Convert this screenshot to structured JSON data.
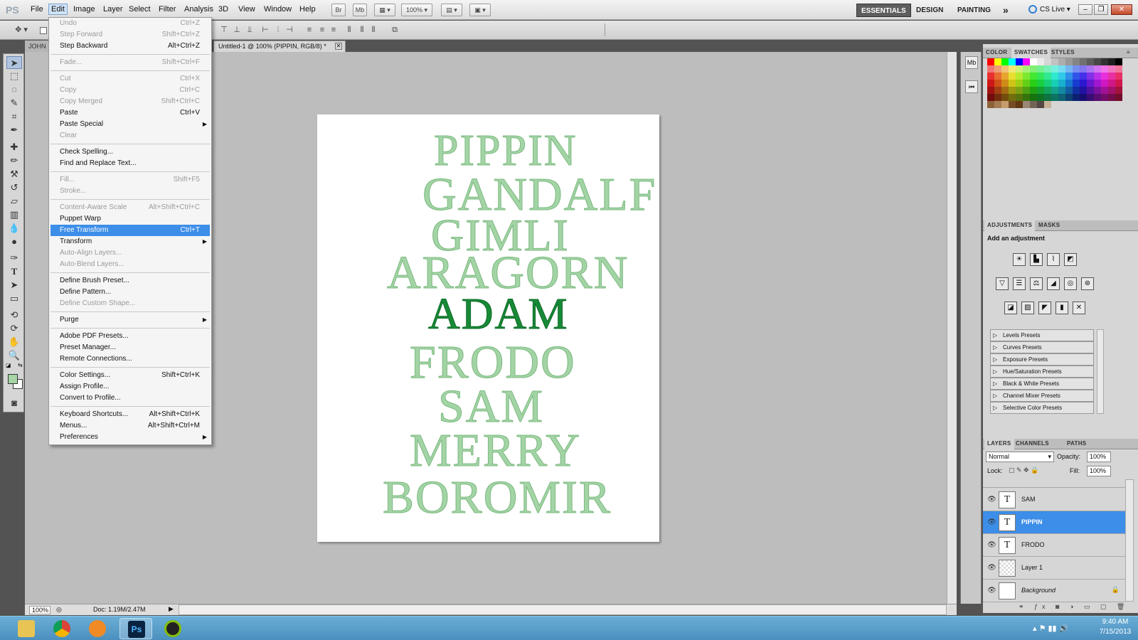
{
  "menubar": {
    "logo": "PS",
    "items": [
      "File",
      "Edit",
      "Image",
      "Layer",
      "Select",
      "Filter",
      "Analysis",
      "3D",
      "View",
      "Window",
      "Help"
    ],
    "zoom": "100%",
    "bridge": "Br",
    "minibridge": "Mb",
    "workspaces": [
      "ESSENTIALS",
      "DESIGN",
      "PAINTING"
    ],
    "more": "»",
    "cs_live": "CS Live"
  },
  "tabs": {
    "other": "JOHN",
    "active": "Untitled-1 @ 100% (PIPPIN, RGB/8) *"
  },
  "edit_menu": {
    "undo": "Undo",
    "undo_sc": "Ctrl+Z",
    "step_forward": "Step Forward",
    "step_forward_sc": "Shift+Ctrl+Z",
    "step_backward": "Step Backward",
    "step_backward_sc": "Alt+Ctrl+Z",
    "fade": "Fade...",
    "fade_sc": "Shift+Ctrl+F",
    "cut": "Cut",
    "cut_sc": "Ctrl+X",
    "copy": "Copy",
    "copy_sc": "Ctrl+C",
    "copy_merged": "Copy Merged",
    "copy_merged_sc": "Shift+Ctrl+C",
    "paste": "Paste",
    "paste_sc": "Ctrl+V",
    "paste_special": "Paste Special",
    "clear": "Clear",
    "check_spelling": "Check Spelling...",
    "find_replace": "Find and Replace Text...",
    "fill": "Fill...",
    "fill_sc": "Shift+F5",
    "stroke": "Stroke...",
    "content_aware": "Content-Aware Scale",
    "content_aware_sc": "Alt+Shift+Ctrl+C",
    "puppet_warp": "Puppet Warp",
    "free_transform": "Free Transform",
    "free_transform_sc": "Ctrl+T",
    "transform": "Transform",
    "auto_align": "Auto-Align Layers...",
    "auto_blend": "Auto-Blend Layers...",
    "define_brush": "Define Brush Preset...",
    "define_pattern": "Define Pattern...",
    "define_shape": "Define Custom Shape...",
    "purge": "Purge",
    "pdf_presets": "Adobe PDF Presets...",
    "preset_manager": "Preset Manager...",
    "remote": "Remote Connections...",
    "color_settings": "Color Settings...",
    "color_settings_sc": "Shift+Ctrl+K",
    "assign_profile": "Assign Profile...",
    "convert_profile": "Convert to Profile...",
    "keyboard": "Keyboard Shortcuts...",
    "keyboard_sc": "Alt+Shift+Ctrl+K",
    "menus": "Menus...",
    "menus_sc": "Alt+Shift+Ctrl+M",
    "preferences": "Preferences"
  },
  "canvas": {
    "names": [
      "PIPPIN",
      "GANDALF",
      "GIMLI",
      "ARAGORN",
      "ADAM",
      "FRODO",
      "SAM",
      "MERRY",
      "BOROMIR"
    ],
    "light_color": "#a3d4a5",
    "dark_color": "#178a36"
  },
  "status": {
    "zoom": "100%",
    "doc": "Doc: 1.19M/2.47M"
  },
  "panels": {
    "color_tabs": [
      "COLOR",
      "SWATCHES",
      "STYLES"
    ],
    "adjust_tabs": [
      "ADJUSTMENTS",
      "MASKS"
    ],
    "add_adjustment": "Add an adjustment",
    "presets": [
      "Levels Presets",
      "Curves Presets",
      "Exposure Presets",
      "Hue/Saturation Presets",
      "Black & White Presets",
      "Channel Mixer Presets",
      "Selective Color Presets"
    ],
    "layer_tabs": [
      "LAYERS",
      "CHANNELS",
      "PATHS"
    ],
    "blend_mode": "Normal",
    "opacity_label": "Opacity:",
    "opacity": "100%",
    "lock_label": "Lock:",
    "fill_label": "Fill:",
    "fill": "100%",
    "layers": [
      "SAM",
      "PIPPIN",
      "FRODO",
      "Layer 1",
      "Background"
    ],
    "text_thumb": "T"
  },
  "taskbar": {
    "time": "9:40 AM",
    "date": "7/15/2013",
    "ps_label": "Ps"
  }
}
